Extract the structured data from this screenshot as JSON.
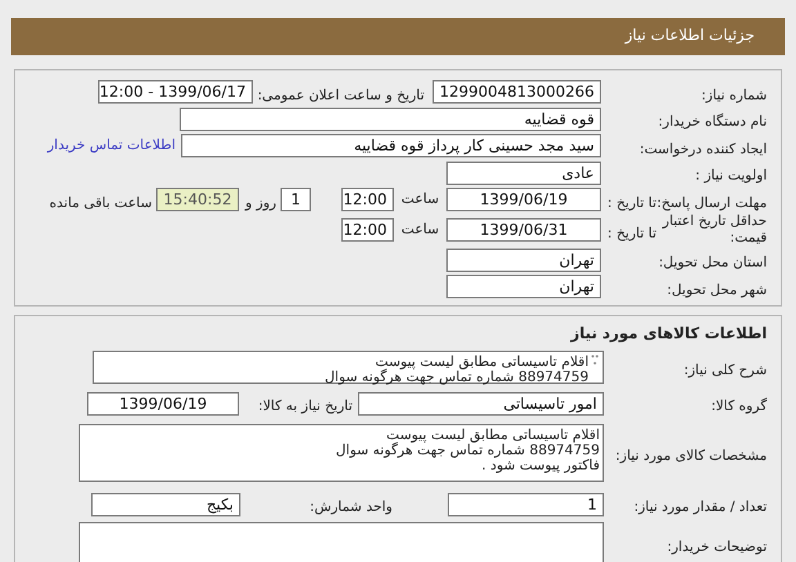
{
  "header": {
    "title": "جزئیات اطلاعات نیاز"
  },
  "need": {
    "need_number": {
      "label": "شماره نیاز:",
      "value": "1299004813000266"
    },
    "announce": {
      "label": "تاریخ و ساعت اعلان عمومی:",
      "value": "1399/06/17 - 12:00"
    },
    "buyer": {
      "label": "نام دستگاه خریدار:",
      "value": "قوه قضاییه"
    },
    "creator": {
      "label": "ایجاد کننده درخواست:",
      "value": "سید مجد حسینی کار پرداز  قوه قضاییه",
      "link": "اطلاعات تماس خریدار"
    },
    "priority": {
      "label": "اولویت نیاز :",
      "value": "عادی"
    },
    "deadline": {
      "label": "مهلت ارسال پاسخ:",
      "to_label": "تا تاریخ :",
      "date": "1399/06/19",
      "time_label": "ساعت",
      "time": "12:00",
      "days": "1",
      "days_label": "روز و",
      "remaining": "15:40:52",
      "remaining_label": "ساعت باقی مانده"
    },
    "validity": {
      "label": "حداقل تاریخ اعتبار قیمت:",
      "to_label": "تا تاریخ :",
      "date": "1399/06/31",
      "time_label": "ساعت",
      "time": "12:00"
    },
    "province": {
      "label": "استان محل تحویل:",
      "value": "تهران"
    },
    "city": {
      "label": "شهر محل تحویل:",
      "value": "تهران"
    }
  },
  "goods": {
    "title": "اطلاعات کالاهای مورد نیاز",
    "summary": {
      "label": "شرح کلی نیاز:",
      "lines": [
        "اقلام تاسیساتی مطابق لیست پیوست",
        "88974759 شماره تماس جهت هرگونه سوال"
      ]
    },
    "group": {
      "label": "گروه کالا:",
      "value": "امور تاسیساتی",
      "date_label": "تاریخ نیاز به کالا:",
      "date": "1399/06/19"
    },
    "specs": {
      "label": "مشخصات کالای مورد نیاز:",
      "lines": [
        "اقلام تاسیساتی مطابق لیست پیوست",
        "88974759 شماره تماس جهت هرگونه سوال",
        "فاکتور پیوست شود ."
      ]
    },
    "quantity": {
      "label": "تعداد / مقدار مورد نیاز:",
      "value": "1",
      "unit_label": "واحد شمارش:",
      "unit": "بکیج"
    },
    "notes": {
      "label": "توضیحات خریدار:"
    }
  }
}
